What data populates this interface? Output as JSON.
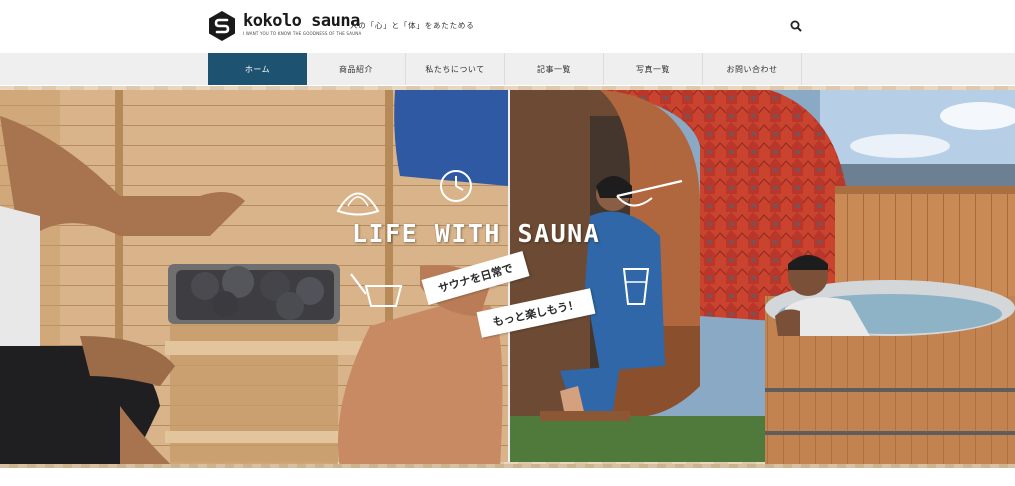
{
  "header": {
    "brand_name": "kokolo sauna",
    "brand_tagline": "I WANT YOU TO KNOW THE GOODNESS OF THE SAUNA",
    "tagline": "人の「心」と「体」をあたためる",
    "search_icon": "search-icon"
  },
  "nav": {
    "items": [
      {
        "label": "ホーム",
        "active": true
      },
      {
        "label": "商品紹介",
        "active": false
      },
      {
        "label": "私たちについて",
        "active": false
      },
      {
        "label": "記事一覧",
        "active": false
      },
      {
        "label": "写真一覧",
        "active": false
      },
      {
        "label": "お問い合わせ",
        "active": false
      }
    ]
  },
  "hero": {
    "title": "LIFE WITH SAUNA",
    "tape_line1": "サウナを日常で",
    "tape_line2": "もっと楽しもう！",
    "doodle_icons": [
      "sauna-hat-icon",
      "clock-icon",
      "water-ladle-icon",
      "towel-icon",
      "water-glass-icon"
    ]
  },
  "colors": {
    "nav_active": "#1d5270",
    "nav_bg": "#efefef",
    "wood": "#d9b48a",
    "roof": "#c9432f"
  }
}
